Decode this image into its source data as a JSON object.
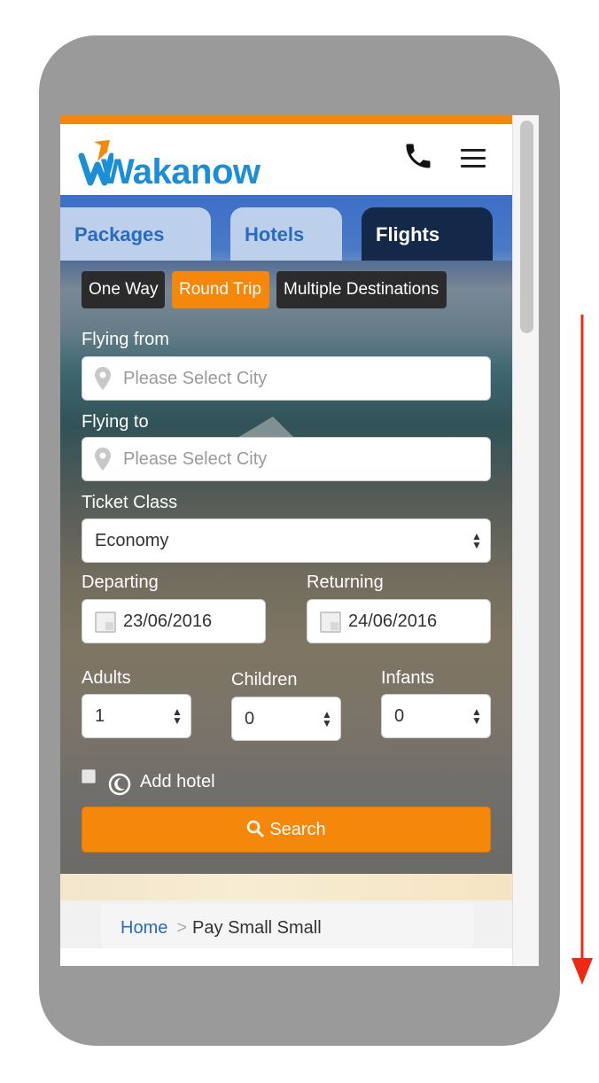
{
  "colors": {
    "accent_orange": "#f5870a",
    "brand_blue": "#2a6bbd",
    "tab_active": "#14294a",
    "tab_inactive": "#bcd0ec",
    "scroll_arrow": "#ee2a12"
  },
  "header": {
    "logo_text": "Wakanow",
    "phone_icon": "phone-icon",
    "menu_icon": "hamburger-menu-icon"
  },
  "tabs": [
    {
      "label": "Packages",
      "active": false
    },
    {
      "label": "Hotels",
      "active": false
    },
    {
      "label": "Flights",
      "active": true
    }
  ],
  "trip_types": [
    {
      "label": "One Way",
      "selected": false
    },
    {
      "label": "Round Trip",
      "selected": true
    },
    {
      "label": "Multiple Destinations",
      "selected": false
    }
  ],
  "form": {
    "flying_from": {
      "label": "Flying from",
      "placeholder": "Please Select City"
    },
    "flying_to": {
      "label": "Flying to",
      "placeholder": "Please Select City"
    },
    "ticket_class": {
      "label": "Ticket Class",
      "value": "Economy"
    },
    "departing": {
      "label": "Departing",
      "value": "23/06/2016"
    },
    "returning": {
      "label": "Returning",
      "value": "24/06/2016"
    },
    "adults": {
      "label": "Adults",
      "value": "1"
    },
    "children": {
      "label": "Children",
      "value": "0"
    },
    "infants": {
      "label": "Infants",
      "value": "0"
    },
    "add_hotel": {
      "label": "Add hotel",
      "checked": false
    },
    "search_button": "Search"
  },
  "breadcrumb": {
    "home": "Home",
    "separator": ">",
    "current": "Pay Small Small"
  }
}
